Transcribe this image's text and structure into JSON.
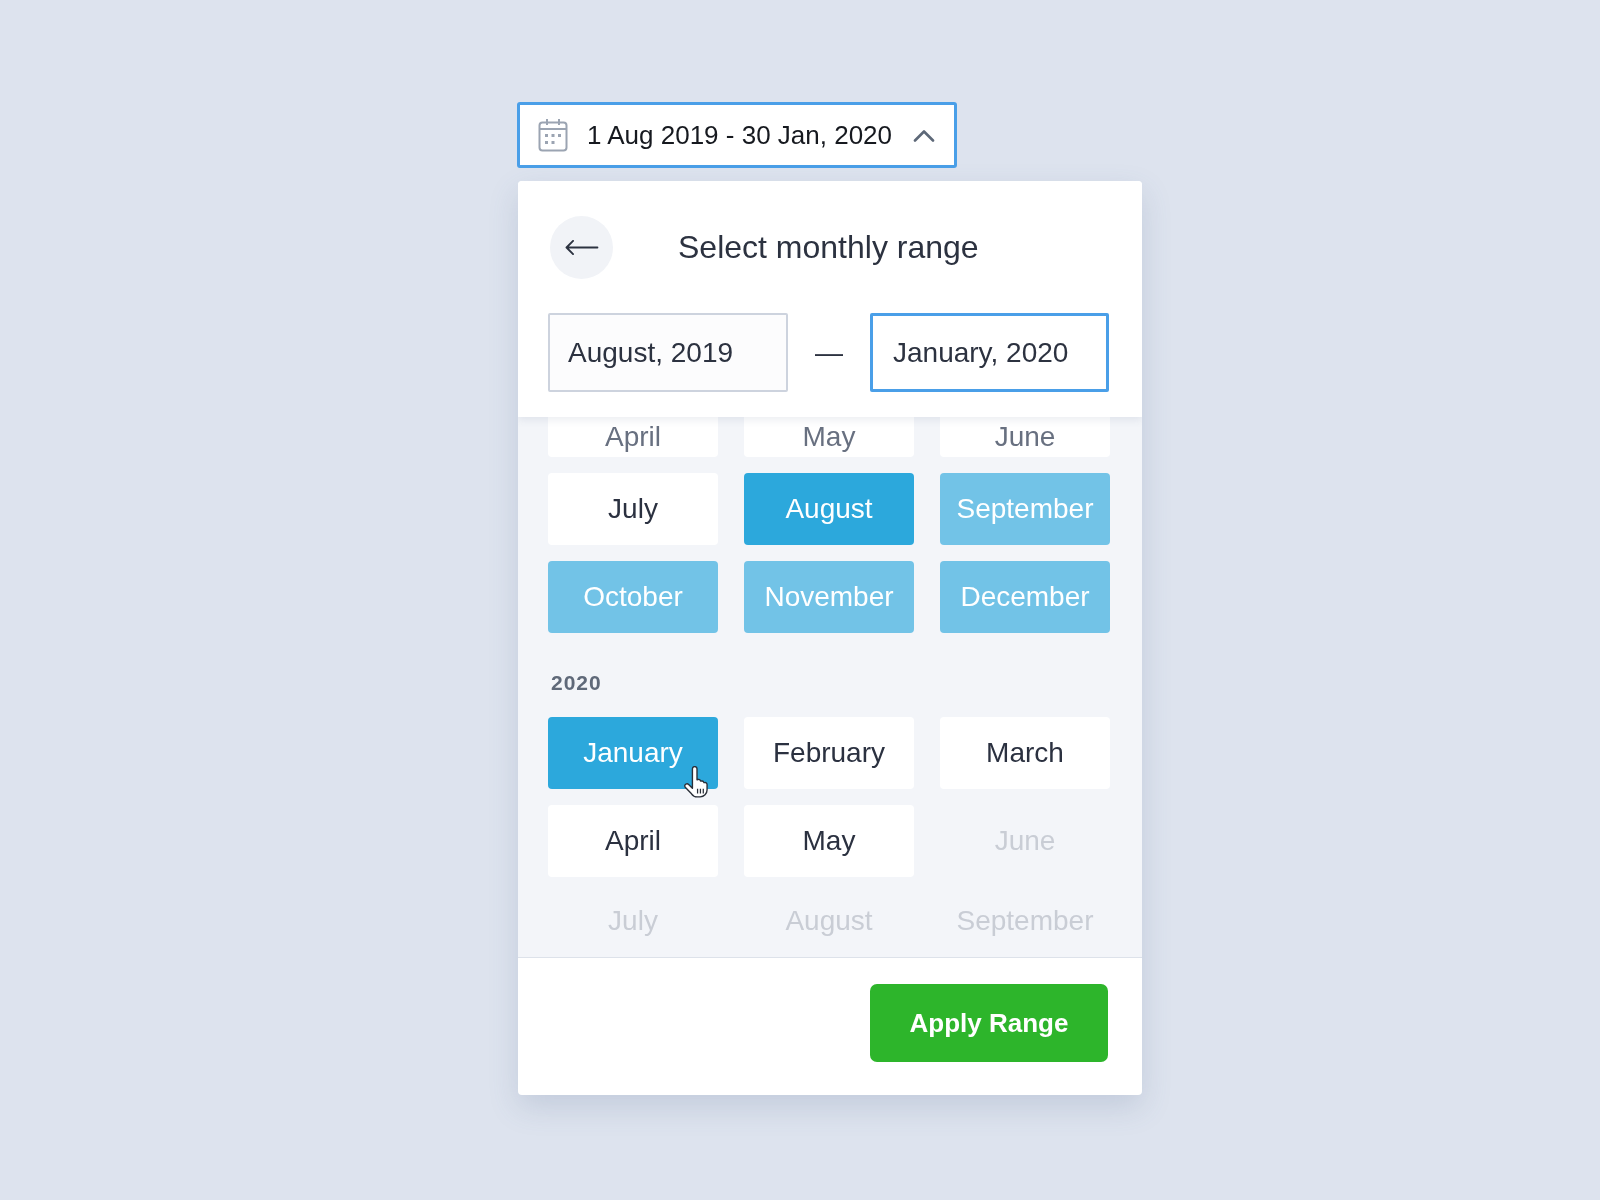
{
  "trigger": {
    "value": "1 Aug 2019 - 30 Jan, 2020",
    "expanded": true
  },
  "panel": {
    "title": "Select monthly range",
    "start_field": {
      "value": "August, 2019",
      "focused": false
    },
    "separator": "—",
    "end_field": {
      "value": "January, 2020",
      "focused": true
    },
    "years": [
      {
        "months": [
          {
            "label": "April",
            "selected": false,
            "in_range": false,
            "disabled": false,
            "hovered": false
          },
          {
            "label": "May",
            "selected": false,
            "in_range": false,
            "disabled": false,
            "hovered": false
          },
          {
            "label": "June",
            "selected": false,
            "in_range": false,
            "disabled": false,
            "hovered": false
          },
          {
            "label": "July",
            "selected": false,
            "in_range": false,
            "disabled": false,
            "hovered": false
          },
          {
            "label": "August",
            "selected": true,
            "in_range": false,
            "disabled": false,
            "hovered": false
          },
          {
            "label": "September",
            "selected": false,
            "in_range": true,
            "disabled": false,
            "hovered": false
          },
          {
            "label": "October",
            "selected": false,
            "in_range": true,
            "disabled": false,
            "hovered": false
          },
          {
            "label": "November",
            "selected": false,
            "in_range": true,
            "disabled": false,
            "hovered": false
          },
          {
            "label": "December",
            "selected": false,
            "in_range": true,
            "disabled": false,
            "hovered": false
          }
        ]
      },
      {
        "label": "2020",
        "months": [
          {
            "label": "January",
            "selected": true,
            "in_range": false,
            "disabled": false,
            "hovered": true
          },
          {
            "label": "February",
            "selected": false,
            "in_range": false,
            "disabled": false,
            "hovered": false
          },
          {
            "label": "March",
            "selected": false,
            "in_range": false,
            "disabled": false,
            "hovered": false
          },
          {
            "label": "April",
            "selected": false,
            "in_range": false,
            "disabled": false,
            "hovered": false
          },
          {
            "label": "May",
            "selected": false,
            "in_range": false,
            "disabled": false,
            "hovered": false
          },
          {
            "label": "June",
            "selected": false,
            "in_range": false,
            "disabled": true,
            "hovered": false
          },
          {
            "label": "July",
            "selected": false,
            "in_range": false,
            "disabled": true,
            "hovered": false
          },
          {
            "label": "August",
            "selected": false,
            "in_range": false,
            "disabled": true,
            "hovered": false
          },
          {
            "label": "September",
            "selected": false,
            "in_range": false,
            "disabled": true,
            "hovered": false
          }
        ]
      }
    ],
    "apply_button": "Apply Range"
  }
}
